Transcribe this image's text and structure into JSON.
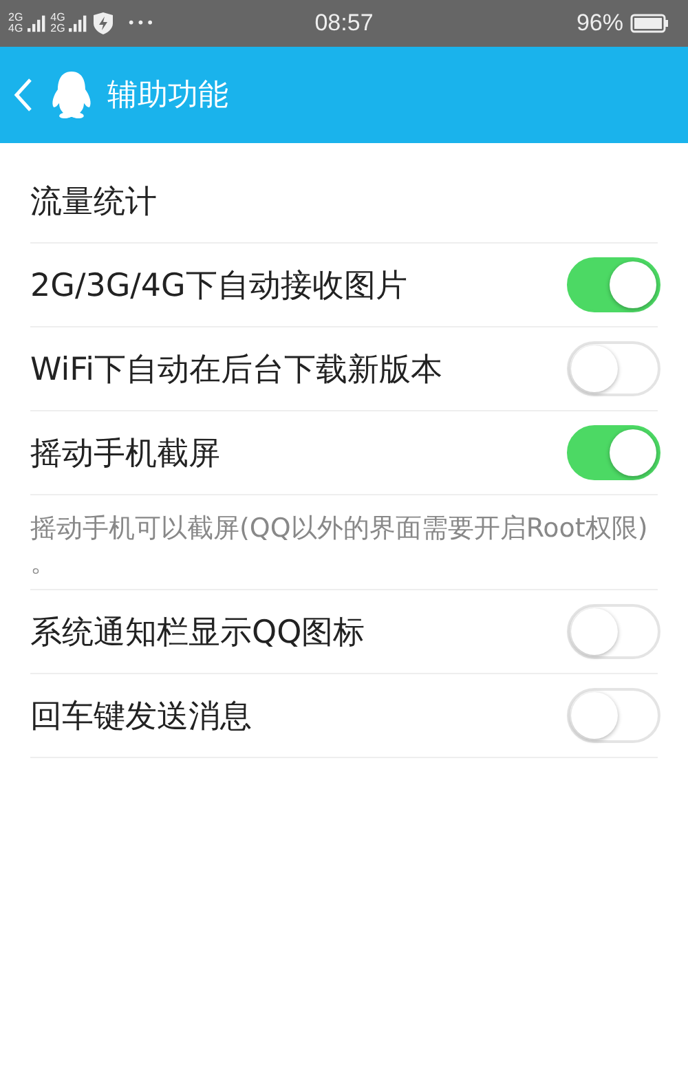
{
  "status_bar": {
    "signal_labels": [
      "2G",
      "4G",
      "4G",
      "2G"
    ],
    "more": "•••",
    "time": "08:57",
    "battery": "96%"
  },
  "header": {
    "title": "辅助功能"
  },
  "items": [
    {
      "kind": "plain",
      "label": "流量统计"
    },
    {
      "kind": "toggle",
      "label": "2G/3G/4G下自动接收图片",
      "on": true
    },
    {
      "kind": "toggle",
      "label": "WiFi下自动在后台下载新版本",
      "on": false
    },
    {
      "kind": "toggle",
      "label": "摇动手机截屏",
      "on": true
    },
    {
      "kind": "note",
      "label": "摇动手机可以截屏(QQ以外的界面需要开启Root权限) 。"
    },
    {
      "kind": "toggle",
      "label": "系统通知栏显示QQ图标",
      "on": false
    },
    {
      "kind": "toggle",
      "label": "回车键发送消息",
      "on": false
    }
  ]
}
